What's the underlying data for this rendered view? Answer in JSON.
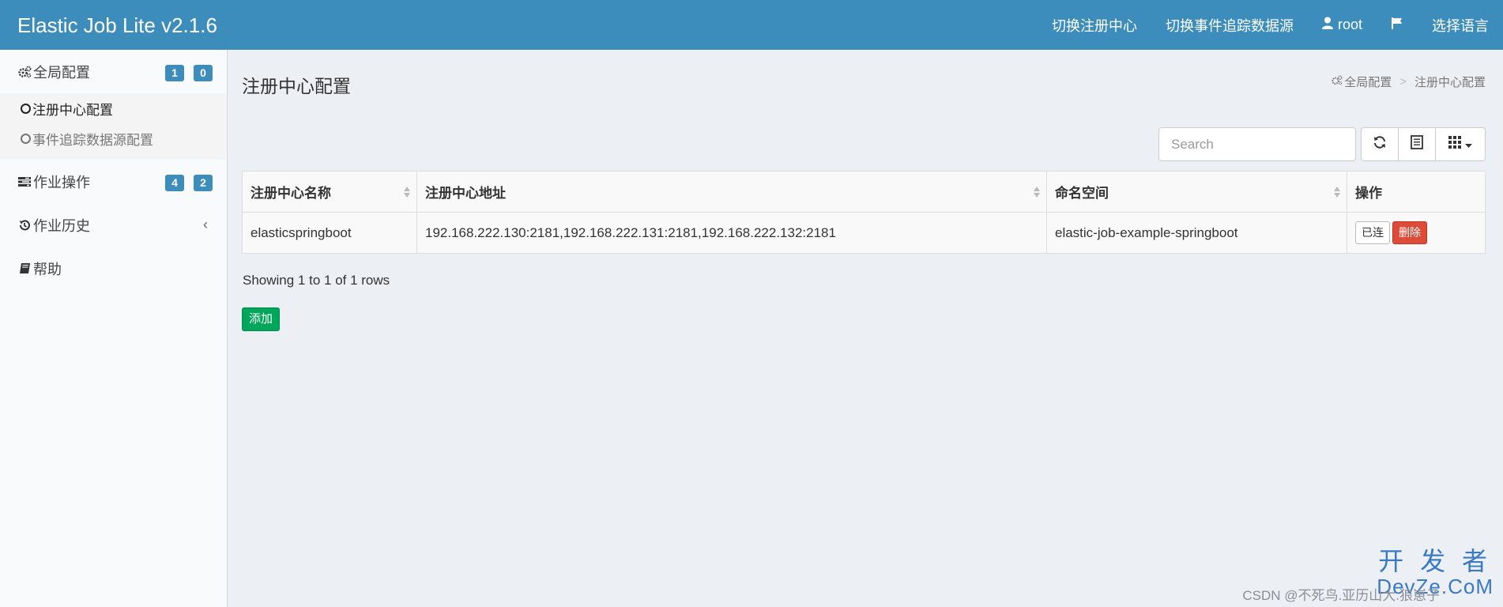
{
  "header": {
    "brand": "Elastic Job Lite v2.1.6",
    "nav": {
      "switch_registry": "切换注册中心",
      "switch_event_source": "切换事件追踪数据源",
      "user": "root",
      "language": "选择语言"
    }
  },
  "sidebar": {
    "global_config": {
      "label": "全局配置",
      "badge1": "1",
      "badge2": "0"
    },
    "sub_items": [
      {
        "label": "注册中心配置"
      },
      {
        "label": "事件追踪数据源配置"
      }
    ],
    "job_ops": {
      "label": "作业操作",
      "badge1": "4",
      "badge2": "2"
    },
    "job_history": {
      "label": "作业历史"
    },
    "help": {
      "label": "帮助"
    }
  },
  "main": {
    "title": "注册中心配置",
    "breadcrumb": {
      "parent": "全局配置",
      "current": "注册中心配置"
    },
    "search": {
      "placeholder": "Search"
    },
    "table": {
      "columns": [
        "注册中心名称",
        "注册中心地址",
        "命名空间",
        "操作"
      ],
      "rows": [
        {
          "name": "elasticspringboot",
          "address": "192.168.222.130:2181,192.168.222.131:2181,192.168.222.132:2181",
          "namespace": "elastic-job-example-springboot",
          "action_connected": "已连",
          "action_delete": "删除"
        }
      ]
    },
    "showing": "Showing 1 to 1 of 1 rows",
    "add_button": "添加"
  },
  "watermark": {
    "csdn": "CSDN @不死鸟.亚历山大.狼崽子",
    "logo_line1": "开 发 者",
    "logo_line2": "DevZe.CoM"
  },
  "colors": {
    "header": "#3c8dbc",
    "badge": "#3c8dbc",
    "delete": "#dd4b39",
    "add": "#00a65a"
  }
}
